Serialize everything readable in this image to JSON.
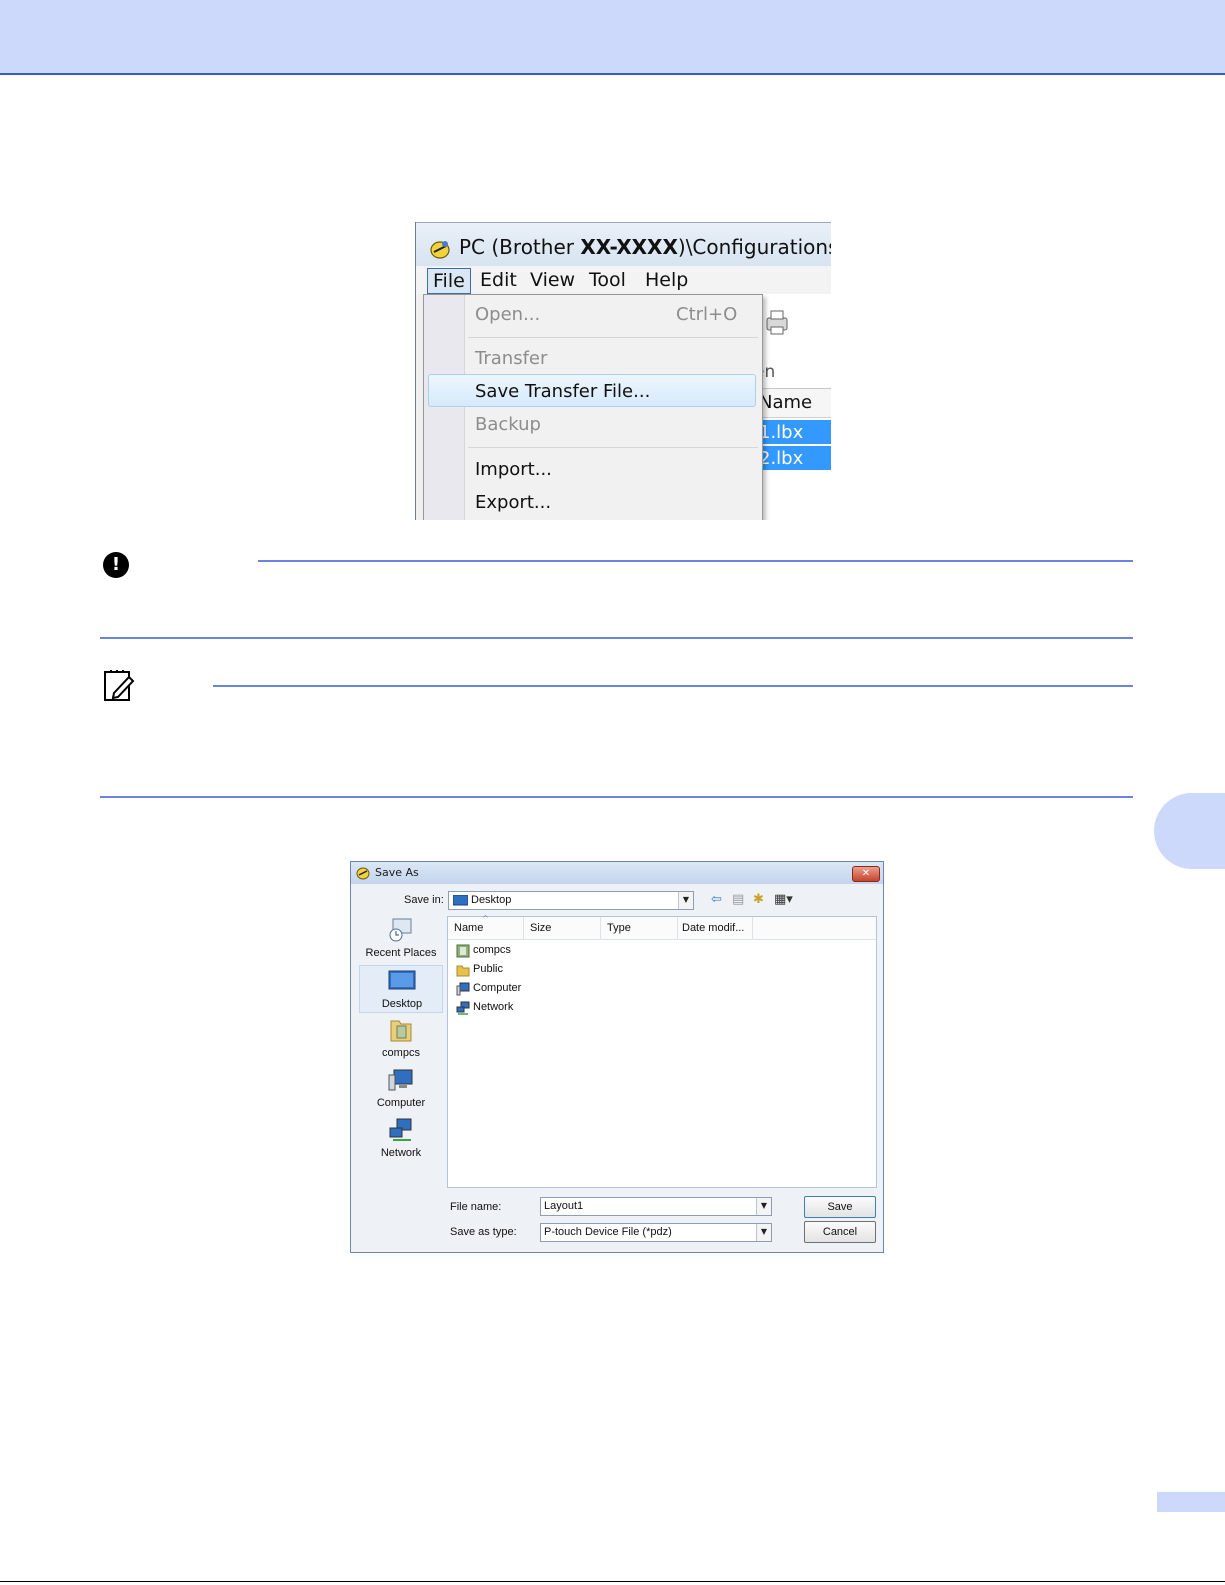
{
  "page": {
    "important_icon_glyph": "!",
    "colors": {
      "band": "#cdd9fb",
      "rule": "#6b84e0",
      "menu_highlight": "#d6eafb",
      "selection": "#3399ff"
    }
  },
  "ptouch_window": {
    "title_prefix": "PC (Brother ",
    "title_model": "XX-XXXX",
    "title_suffix": ")\\Configurations - P-tou",
    "menus": [
      "File",
      "Edit",
      "View",
      "Tool",
      "Help"
    ],
    "toolbar_label_fragment": "en",
    "column_header_fragment": "Name",
    "selected_rows": [
      "1.lbx",
      "2.lbx"
    ],
    "file_menu": {
      "open": {
        "label": "Open...",
        "shortcut": "Ctrl+O"
      },
      "transfer": "Transfer",
      "save_transfer_file": "Save Transfer File...",
      "backup": "Backup",
      "import": "Import...",
      "export": "Export..."
    }
  },
  "save_as_dialog": {
    "title": "Save As",
    "save_in_label": "Save in:",
    "save_in_value": "Desktop",
    "places": [
      "Recent Places",
      "Desktop",
      "compcs",
      "Computer",
      "Network"
    ],
    "columns": [
      "Name",
      "Size",
      "Type",
      "Date modif..."
    ],
    "files": [
      "compcs",
      "Public",
      "Computer",
      "Network"
    ],
    "file_name_label": "File name:",
    "file_name_value": "Layout1",
    "save_as_type_label": "Save as type:",
    "save_as_type_value": "P-touch Device File (*pdz)",
    "save_button": "Save",
    "cancel_button": "Cancel",
    "close_glyph": "✕"
  }
}
